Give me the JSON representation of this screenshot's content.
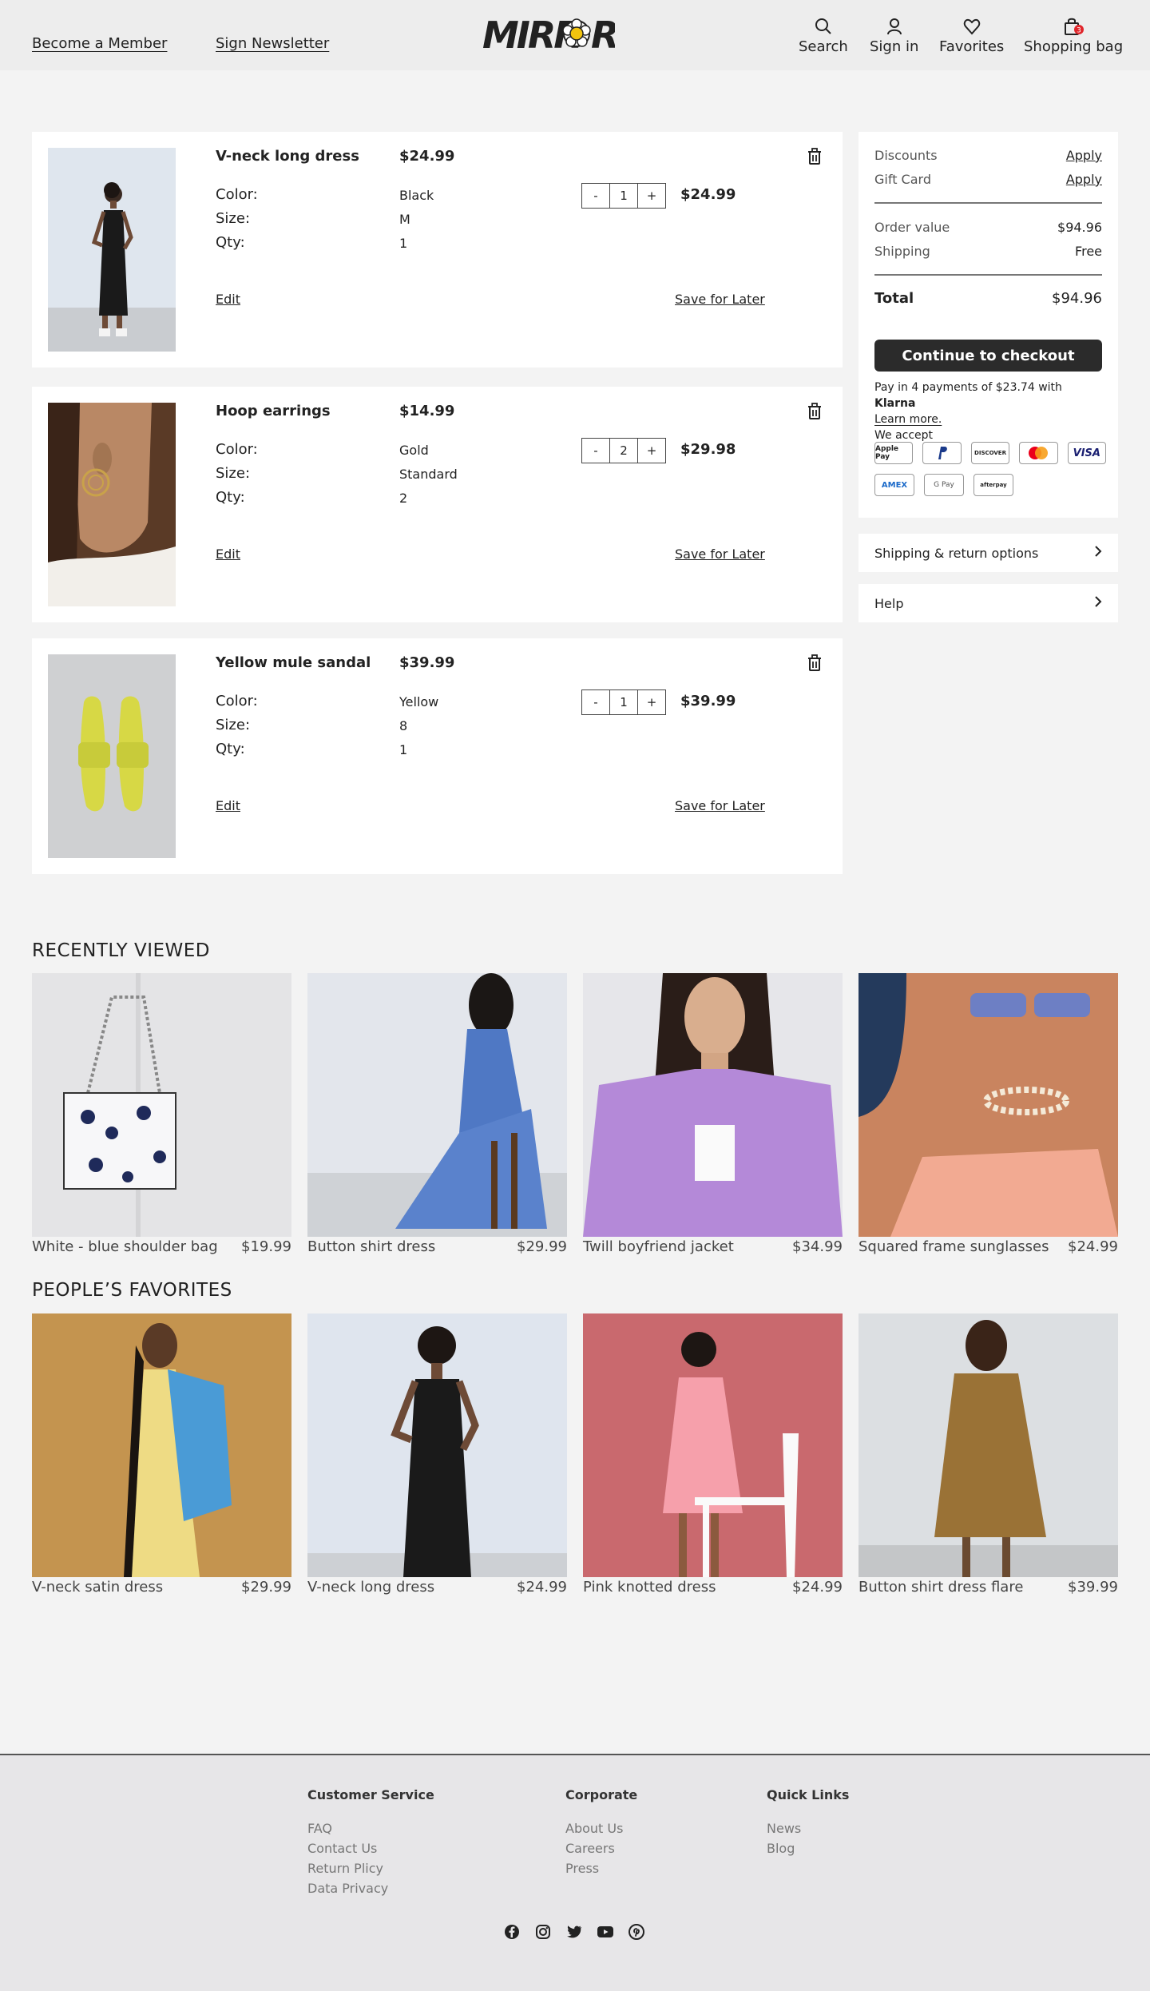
{
  "header": {
    "become_member": "Become a Member",
    "sign_newsletter": "Sign Newsletter",
    "logo_text": "MIRROR",
    "nav": [
      {
        "label": "Search",
        "icon": "search-icon"
      },
      {
        "label": "Sign in",
        "icon": "user-icon"
      },
      {
        "label": "Favorites",
        "icon": "heart-icon"
      },
      {
        "label": "Shopping bag",
        "icon": "bag-icon"
      }
    ],
    "bag_count": "3"
  },
  "cart": {
    "color_label": "Color:",
    "size_label": "Size:",
    "qty_label": "Qty:",
    "edit_label": "Edit",
    "save_label": "Save for Later",
    "minus": "-",
    "plus": "+",
    "items": [
      {
        "name": "V-neck long dress",
        "price": "$24.99",
        "color": "Black",
        "size": "M",
        "qty": "1",
        "total": "$24.99"
      },
      {
        "name": "Hoop earrings",
        "price": "$14.99",
        "color": "Gold",
        "size": "Standard",
        "qty": "2",
        "total": "$29.98"
      },
      {
        "name": "Yellow mule sandal",
        "price": "$39.99",
        "color": "Yellow",
        "size": "8",
        "qty": "1",
        "total": "$39.99"
      }
    ]
  },
  "summary": {
    "discounts": "Discounts",
    "gift_card": "Gift Card",
    "apply": "Apply",
    "order_value_label": "Order value",
    "order_value": "$94.96",
    "shipping_label": "Shipping",
    "shipping_value": "Free",
    "total_label": "Total",
    "total_value": "$94.96",
    "checkout": "Continue to checkout",
    "klarna_text": "Pay in 4 payments of $23.74 with",
    "klarna_brand": "Klarna",
    "learn_more": "Learn more.",
    "we_accept": "We accept",
    "payment_methods": [
      "Apple Pay",
      "PayPal",
      "DISCOVER",
      "Mastercard",
      "VISA",
      "AMEX",
      "G Pay",
      "afterpay"
    ]
  },
  "panels": {
    "shipping": "Shipping & return options",
    "help": "Help"
  },
  "recently_viewed": {
    "title": "RECENTLY VIEWED",
    "items": [
      {
        "name": "White - blue shoulder bag",
        "price": "$19.99"
      },
      {
        "name": "Button shirt dress",
        "price": "$29.99"
      },
      {
        "name": "Twill boyfriend jacket",
        "price": "$34.99"
      },
      {
        "name": "Squared frame sunglasses",
        "price": "$24.99"
      }
    ]
  },
  "favorites": {
    "title": "PEOPLE’S FAVORITES",
    "items": [
      {
        "name": "V-neck satin dress",
        "price": "$29.99"
      },
      {
        "name": "V-neck long dress",
        "price": "$24.99"
      },
      {
        "name": "Pink knotted dress",
        "price": "$24.99"
      },
      {
        "name": "Button shirt dress flare",
        "price": "$39.99"
      }
    ]
  },
  "footer": {
    "customer_service": {
      "title": "Customer Service",
      "links": [
        "FAQ",
        "Contact Us",
        "Return Plicy",
        "Data Privacy"
      ]
    },
    "corporate": {
      "title": "Corporate",
      "links": [
        "About Us",
        "Careers",
        "Press"
      ]
    },
    "quick_links": {
      "title": "Quick Links",
      "links": [
        "News",
        "Blog"
      ]
    },
    "social": [
      "facebook-icon",
      "instagram-icon",
      "twitter-icon",
      "youtube-icon",
      "pinterest-icon"
    ]
  },
  "colors": {
    "accent": "#2b2b2b",
    "badge": "#e0262b",
    "page_bg": "#f3f3f3"
  }
}
